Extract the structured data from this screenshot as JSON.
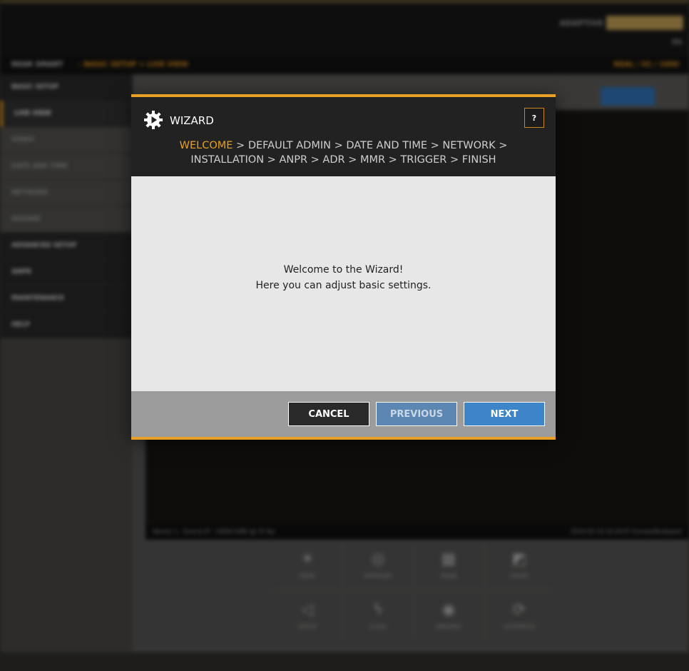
{
  "background_app": {
    "top_bar": {
      "mode_label": "ADAPTIVE",
      "language": "EN"
    },
    "breadcrumb": {
      "title": "REAR SMART",
      "path": " - BASIC SETUP > LIVE VIEW",
      "right": "REAL / 01 / 1000"
    },
    "sidebar": [
      {
        "label": "BASIC SETUP",
        "kind": "section"
      },
      {
        "label": "LIVE VIEW",
        "kind": "active"
      },
      {
        "label": "VIDEO",
        "kind": "sub"
      },
      {
        "label": "DATE AND TIME",
        "kind": "sub"
      },
      {
        "label": "NETWORK",
        "kind": "sub"
      },
      {
        "label": "WIZARD",
        "kind": "sub"
      },
      {
        "label": "ADVANCED SETUP",
        "kind": "section"
      },
      {
        "label": "ANPR",
        "kind": "section"
      },
      {
        "label": "MAINTENANCE",
        "kind": "section"
      },
      {
        "label": "HELP",
        "kind": "section"
      }
    ],
    "video_caption_left": "Sensor 1 - Source IP - 1600x1080 @ 25 fps",
    "video_caption_right": "2024-02-19 10:24:07 Europe/Budapest",
    "controls": [
      {
        "icon": "☀",
        "label": "MODE"
      },
      {
        "icon": "◎",
        "label": "EXPOSURE"
      },
      {
        "icon": "▦",
        "label": "IMAGE"
      },
      {
        "icon": "◩",
        "label": "COLOR"
      },
      {
        "icon": "◁",
        "label": "OPTICS"
      },
      {
        "icon": "ϟ",
        "label": "FLASH"
      },
      {
        "icon": "◉",
        "label": "ENHANCE"
      },
      {
        "icon": "⟳",
        "label": "AUTOFOCUS"
      }
    ]
  },
  "wizard": {
    "title": "WIZARD",
    "help_label": "?",
    "steps_line1": [
      {
        "label": "WELCOME",
        "current": true
      },
      {
        "label": "DEFAULT ADMIN",
        "current": false
      },
      {
        "label": "DATE AND TIME",
        "current": false
      },
      {
        "label": "NETWORK",
        "current": false
      }
    ],
    "steps_line2": [
      {
        "label": "INSTALLATION",
        "current": false
      },
      {
        "label": "ANPR",
        "current": false
      },
      {
        "label": "ADR",
        "current": false
      },
      {
        "label": "MMR",
        "current": false
      },
      {
        "label": "TRIGGER",
        "current": false
      },
      {
        "label": "FINISH",
        "current": false
      }
    ],
    "separator": ">",
    "body": {
      "line1": "Welcome to the Wizard!",
      "line2": "Here you can adjust basic settings."
    },
    "buttons": {
      "cancel": "CANCEL",
      "previous": "PREVIOUS",
      "next": "NEXT"
    }
  },
  "colors": {
    "accent": "#e8a127",
    "primary_button": "#3d84c8",
    "disabled_button": "#5c87b3"
  }
}
